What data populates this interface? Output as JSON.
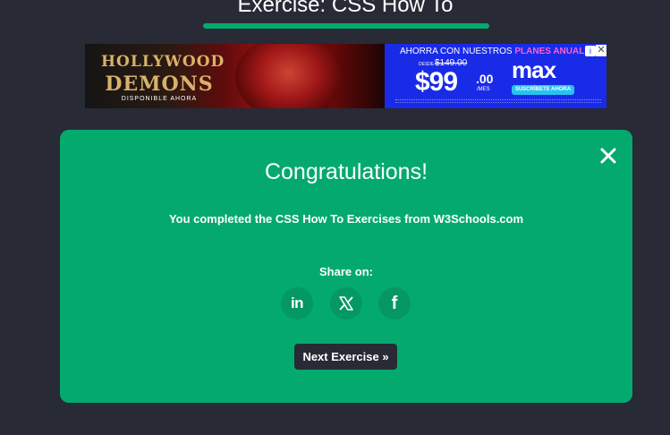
{
  "page": {
    "title": "Exercise: CSS How To",
    "accent_color": "#04aa6d",
    "background_color": "#282a35"
  },
  "ad": {
    "left": {
      "title_line1": "HOLLYWOOD",
      "title_line2": "DEMONS",
      "subtitle": "DISPONIBLE AHORA"
    },
    "right": {
      "promo_text": "AHORRA CON NUESTROS ",
      "promo_accent": "PLANES ANUAL",
      "adchoices_icon": "i",
      "close_icon": "✕",
      "desde_label": "DESDE",
      "old_price": "$149.00",
      "price_main": "$99",
      "price_cents": ".00",
      "per_label": "/MES",
      "brand": "max",
      "cta_label": "SUSCRÍBETE AHORA"
    }
  },
  "modal": {
    "heading": "Congratulations!",
    "message": "You completed the CSS How To Exercises from W3Schools.com",
    "share_label": "Share on:",
    "share_buttons": [
      {
        "network": "linkedin",
        "icon": "linkedin-icon",
        "glyph": "in"
      },
      {
        "network": "x",
        "icon": "x-icon",
        "glyph": "X"
      },
      {
        "network": "facebook",
        "icon": "facebook-icon",
        "glyph": "f"
      }
    ],
    "next_button_label": "Next Exercise »",
    "close_icon": "close-icon"
  }
}
